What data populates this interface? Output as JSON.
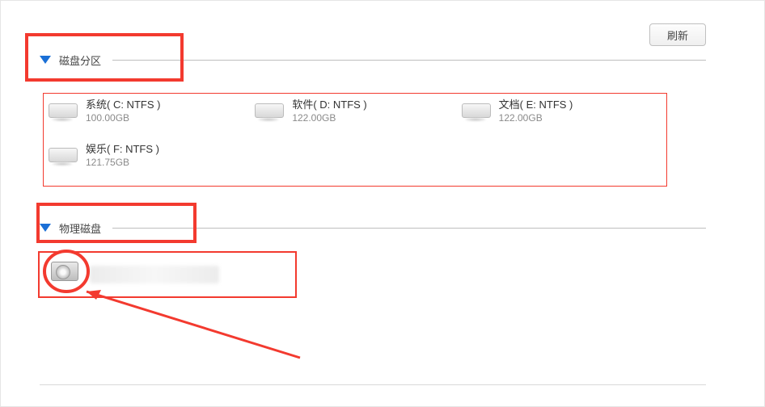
{
  "buttons": {
    "refresh": "刷新"
  },
  "sections": {
    "partitions_title": "磁盘分区",
    "physical_title": "物理磁盘"
  },
  "partitions": [
    {
      "name": "系统( C: NTFS )",
      "size": "100.00GB"
    },
    {
      "name": "软件( D: NTFS )",
      "size": "122.00GB"
    },
    {
      "name": "文档( E: NTFS )",
      "size": "122.00GB"
    },
    {
      "name": "娱乐( F: NTFS )",
      "size": "121.75GB"
    }
  ],
  "physical_disks": [
    {
      "name": ""
    }
  ],
  "annotations": {
    "highlight_partitions_header": true,
    "highlight_physical_header": true,
    "circle_physical_icon": true,
    "arrow_to_physical": true,
    "colors": {
      "highlight": "#f33a2f"
    }
  }
}
